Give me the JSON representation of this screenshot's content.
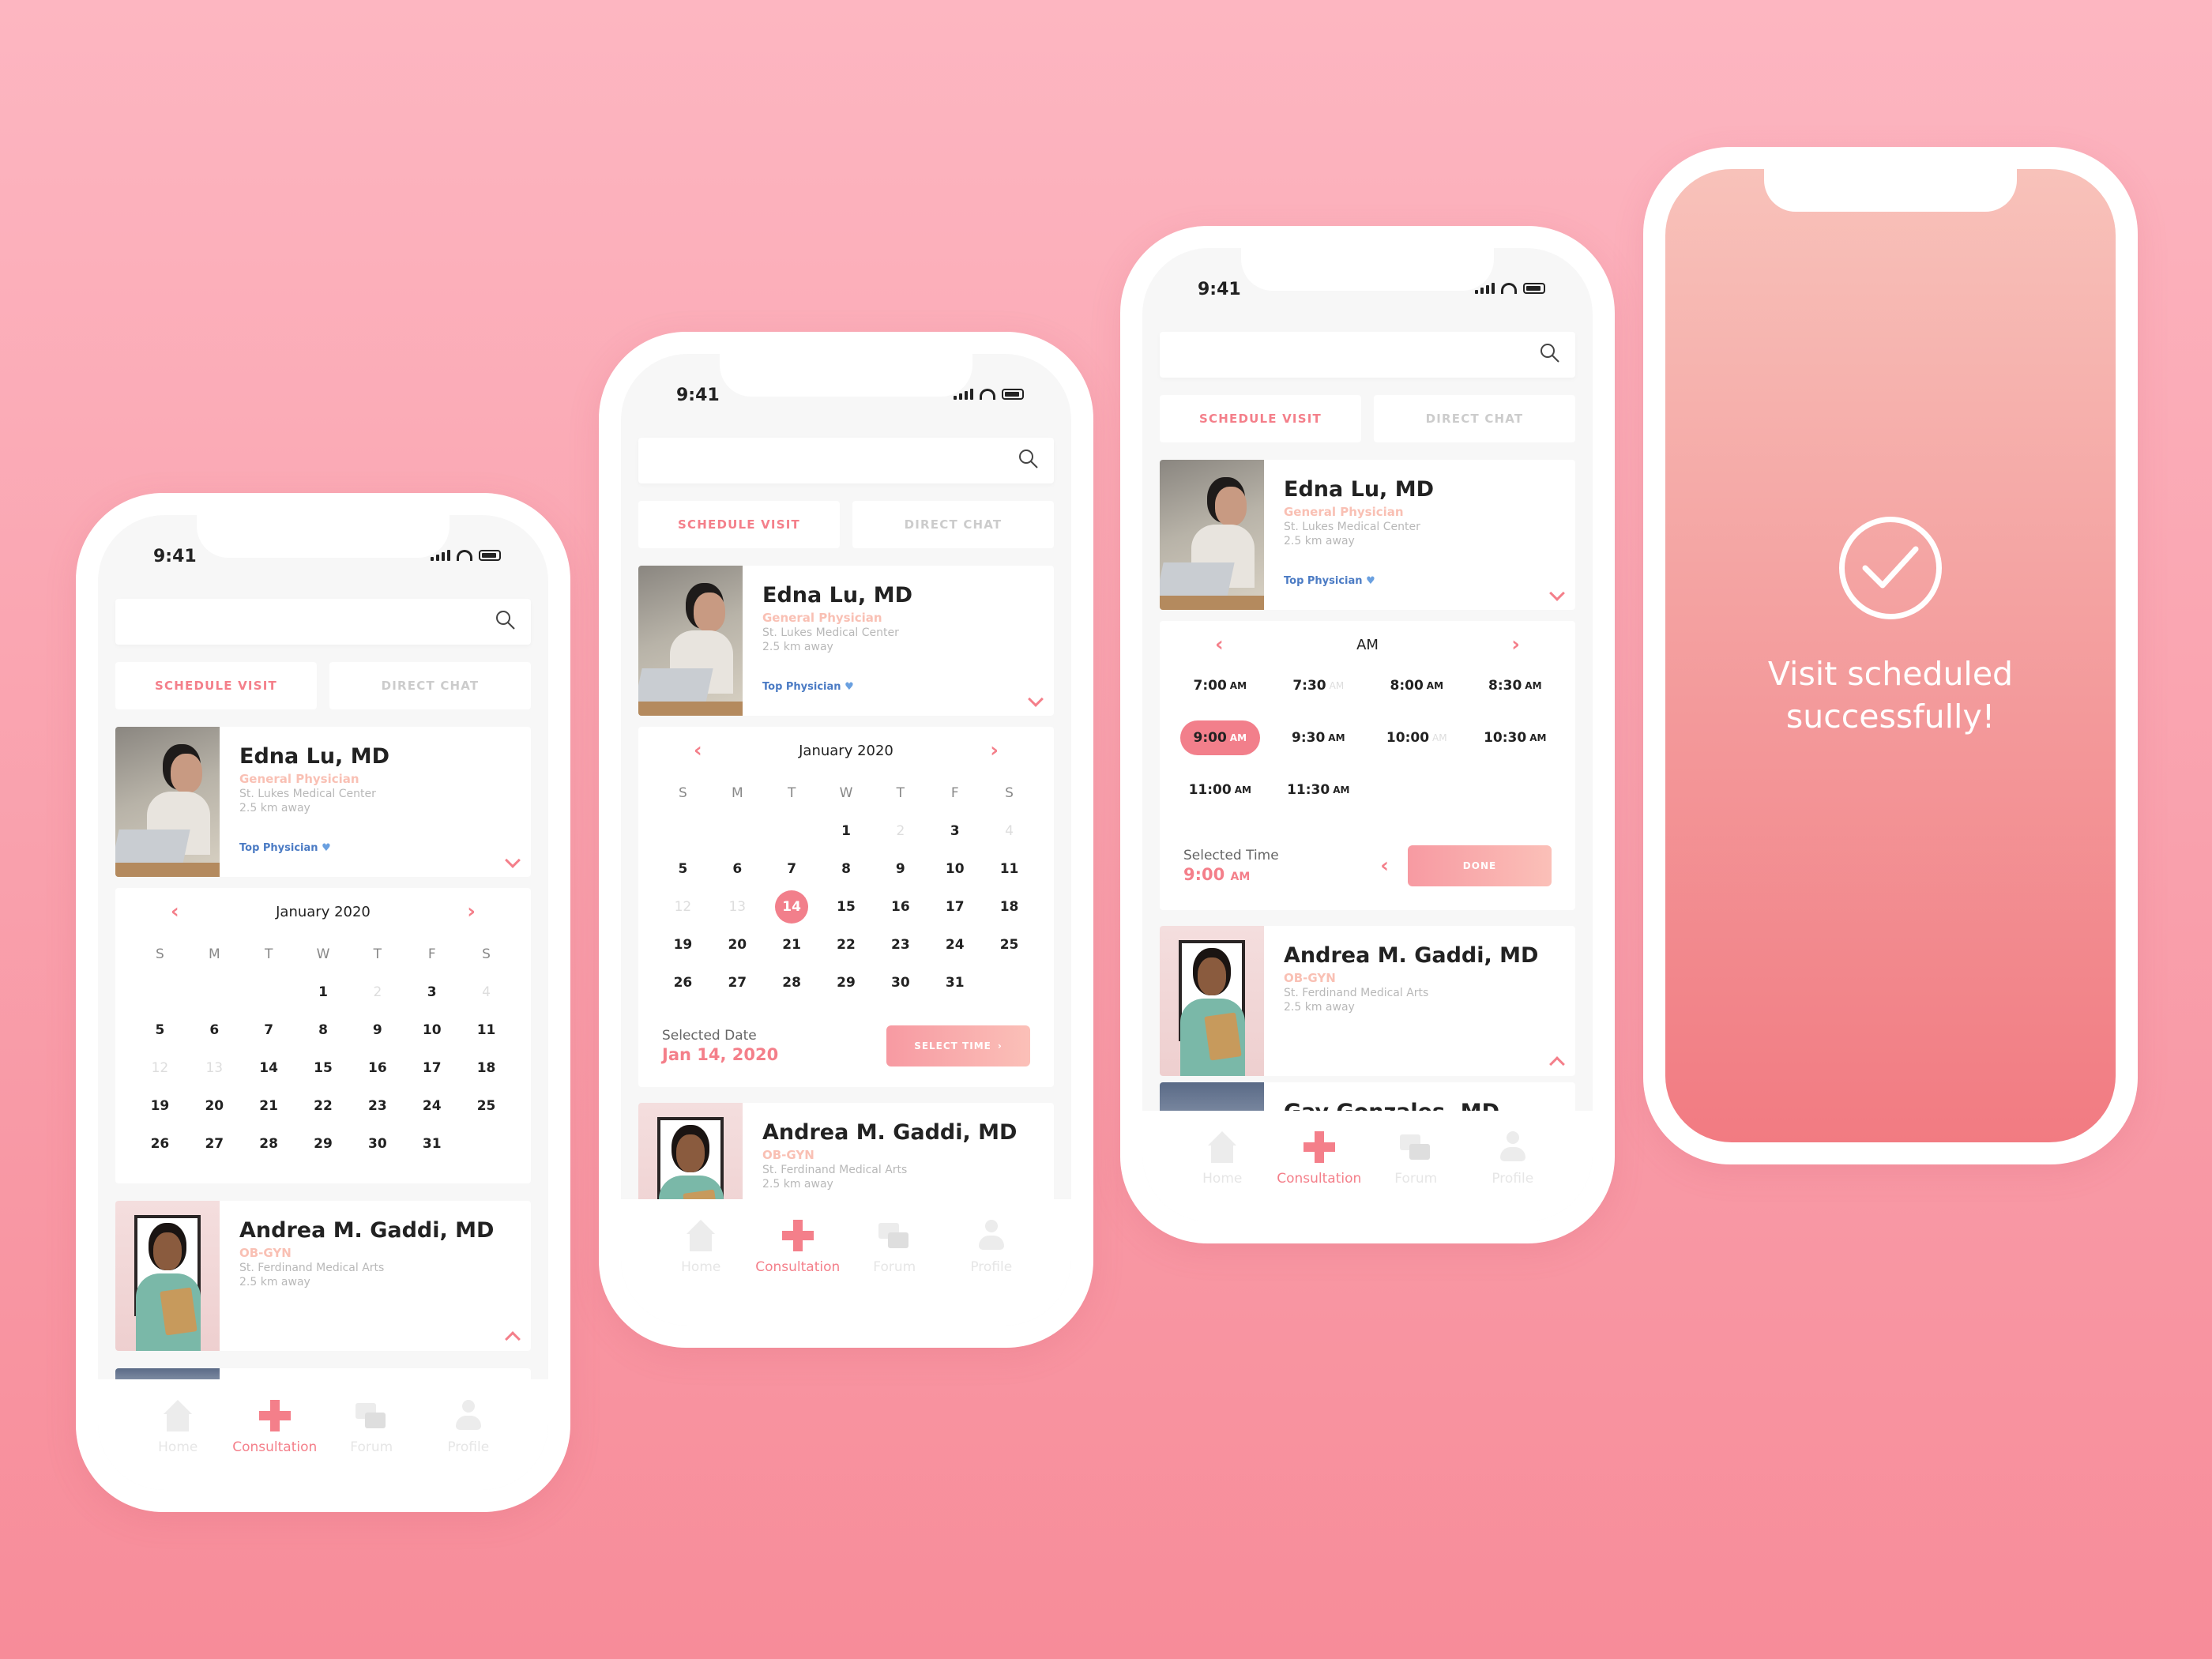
{
  "status_time": "9:41",
  "search": {
    "placeholder": ""
  },
  "tabs": {
    "schedule": "SCHEDULE VISIT",
    "chat": "DIRECT CHAT"
  },
  "doctors": [
    {
      "name": "Edna Lu, MD",
      "specialty": "General Physician",
      "hospital": "St. Lukes Medical Center",
      "distance": "2.5 km away",
      "badge": "Top Physician"
    },
    {
      "name": "Andrea M. Gaddi, MD",
      "specialty": "OB-GYN",
      "hospital": "St. Ferdinand Medical Arts",
      "distance": "2.5 km away"
    },
    {
      "name": "Gay Gonzales, MD"
    }
  ],
  "calendar": {
    "month": "January 2020",
    "weekdays": [
      "S",
      "M",
      "T",
      "W",
      "T",
      "F",
      "S"
    ],
    "days": [
      {
        "d": "",
        "f": false
      },
      {
        "d": "",
        "f": false
      },
      {
        "d": "",
        "f": false
      },
      {
        "d": "1",
        "f": false
      },
      {
        "d": "2",
        "f": true
      },
      {
        "d": "3",
        "f": false
      },
      {
        "d": "4",
        "f": true
      },
      {
        "d": "5",
        "f": false
      },
      {
        "d": "6",
        "f": false
      },
      {
        "d": "7",
        "f": false
      },
      {
        "d": "8",
        "f": false
      },
      {
        "d": "9",
        "f": false
      },
      {
        "d": "10",
        "f": false
      },
      {
        "d": "11",
        "f": false
      },
      {
        "d": "12",
        "f": true
      },
      {
        "d": "13",
        "f": true
      },
      {
        "d": "14",
        "f": false
      },
      {
        "d": "15",
        "f": false
      },
      {
        "d": "16",
        "f": false
      },
      {
        "d": "17",
        "f": false
      },
      {
        "d": "18",
        "f": false
      },
      {
        "d": "19",
        "f": false
      },
      {
        "d": "20",
        "f": false
      },
      {
        "d": "21",
        "f": false
      },
      {
        "d": "22",
        "f": false
      },
      {
        "d": "23",
        "f": false
      },
      {
        "d": "24",
        "f": false
      },
      {
        "d": "25",
        "f": false
      },
      {
        "d": "26",
        "f": false
      },
      {
        "d": "27",
        "f": false
      },
      {
        "d": "28",
        "f": false
      },
      {
        "d": "29",
        "f": false
      },
      {
        "d": "30",
        "f": false
      },
      {
        "d": "31",
        "f": false
      },
      {
        "d": "",
        "f": false
      }
    ],
    "selected_day": "14",
    "selected_label": "Selected Date",
    "selected_value": "Jan 14, 2020",
    "button": "SELECT TIME"
  },
  "time": {
    "period": "AM",
    "slots": [
      {
        "t": "7:00",
        "p": "AM",
        "f": false
      },
      {
        "t": "7:30",
        "p": "AM",
        "f": true
      },
      {
        "t": "8:00",
        "p": "AM",
        "f": false
      },
      {
        "t": "8:30",
        "p": "AM",
        "f": false
      },
      {
        "t": "9:00",
        "p": "AM",
        "f": false,
        "sel": true
      },
      {
        "t": "9:30",
        "p": "AM",
        "f": false
      },
      {
        "t": "10:00",
        "p": "AM",
        "f": true
      },
      {
        "t": "10:30",
        "p": "AM",
        "f": false
      },
      {
        "t": "11:00",
        "p": "AM",
        "f": false
      },
      {
        "t": "11:30",
        "p": "AM",
        "f": false
      }
    ],
    "selected_label": "Selected Time",
    "selected_value": "9:00",
    "selected_period": "AM",
    "button": "DONE"
  },
  "nav": {
    "home": "Home",
    "consultation": "Consultation",
    "forum": "Forum",
    "profile": "Profile"
  },
  "success": {
    "line1": "Visit scheduled",
    "line2": "successfully!"
  },
  "colors": {
    "accent": "#f47f8a",
    "badge": "#4b7bc4",
    "specialty": "#f9c0b4"
  }
}
